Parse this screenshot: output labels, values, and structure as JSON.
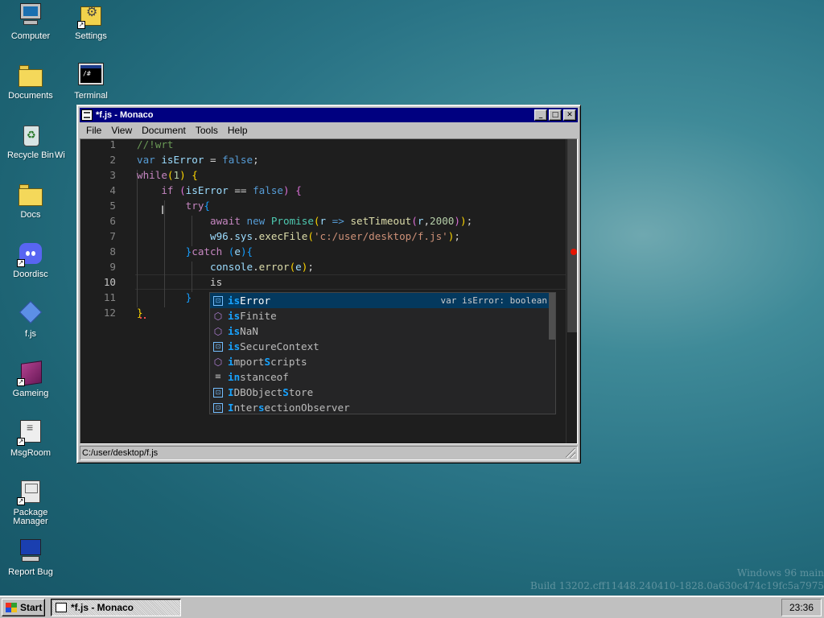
{
  "desktop": {
    "icons": [
      {
        "label": "Computer",
        "icon": "computer-icon"
      },
      {
        "label": "Settings",
        "icon": "settings-icon"
      },
      {
        "label": "Documents",
        "icon": "folder-icon"
      },
      {
        "label": "Terminal",
        "icon": "terminal-icon"
      },
      {
        "label": "Recycle Bin",
        "icon": "recycle-bin-icon"
      },
      {
        "label": "Docs",
        "icon": "folder-icon"
      },
      {
        "label": "Doordisc",
        "icon": "discord-icon"
      },
      {
        "label": "f.js",
        "icon": "diamond-file-icon"
      },
      {
        "label": "Gameing",
        "icon": "cube-icon"
      },
      {
        "label": "MsgRoom",
        "icon": "msgroom-icon"
      },
      {
        "label": "Package Manager",
        "icon": "package-icon"
      },
      {
        "label": "Report Bug",
        "icon": "report-bug-icon"
      }
    ],
    "hidden_icon_fragment": "Wi"
  },
  "window": {
    "title": "*f.js - Monaco",
    "menu": [
      "File",
      "View",
      "Document",
      "Tools",
      "Help"
    ],
    "buttons": {
      "minimize": "_",
      "maximize": "□",
      "close": "✕"
    },
    "status_path": "C:/user/desktop/f.js"
  },
  "editor": {
    "line_numbers": [
      "1",
      "2",
      "3",
      "4",
      "5",
      "6",
      "7",
      "8",
      "9",
      "10",
      "11",
      "12"
    ],
    "active_line": "10",
    "lines": [
      [
        {
          "t": "//!wrt",
          "c": "c-com"
        }
      ],
      [
        {
          "t": "var ",
          "c": "c-kw"
        },
        {
          "t": "isError",
          "c": "c-var"
        },
        {
          "t": " = ",
          "c": ""
        },
        {
          "t": "false",
          "c": "c-kw"
        },
        {
          "t": ";",
          "c": ""
        }
      ],
      [
        {
          "t": "while",
          "c": "c-ctl"
        },
        {
          "t": "(",
          "c": "c-br1"
        },
        {
          "t": "1",
          "c": "c-num"
        },
        {
          "t": ")",
          "c": "c-br1"
        },
        {
          "t": " ",
          "c": ""
        },
        {
          "t": "{",
          "c": "c-br1"
        }
      ],
      [
        {
          "t": "    if ",
          "c": "c-ctl"
        },
        {
          "t": "(",
          "c": "c-br2"
        },
        {
          "t": "isError",
          "c": "c-var"
        },
        {
          "t": " == ",
          "c": ""
        },
        {
          "t": "false",
          "c": "c-kw"
        },
        {
          "t": ")",
          "c": "c-br2"
        },
        {
          "t": " ",
          "c": ""
        },
        {
          "t": "{",
          "c": "c-br2"
        }
      ],
      [
        {
          "t": "        try",
          "c": "c-ctl"
        },
        {
          "t": "{",
          "c": "c-br3"
        }
      ],
      [
        {
          "t": "            await ",
          "c": "c-ctl"
        },
        {
          "t": "new ",
          "c": "c-kw"
        },
        {
          "t": "Promise",
          "c": "c-cls"
        },
        {
          "t": "(",
          "c": "c-br1"
        },
        {
          "t": "r",
          "c": "c-var"
        },
        {
          "t": " => ",
          "c": "c-kw"
        },
        {
          "t": "setTimeout",
          "c": "c-fn"
        },
        {
          "t": "(",
          "c": "c-br2"
        },
        {
          "t": "r",
          "c": "c-var"
        },
        {
          "t": ",",
          "c": ""
        },
        {
          "t": "2000",
          "c": "c-num"
        },
        {
          "t": ")",
          "c": "c-br2"
        },
        {
          "t": ")",
          "c": "c-br1"
        },
        {
          "t": ";",
          "c": ""
        }
      ],
      [
        {
          "t": "            w96",
          "c": "c-var"
        },
        {
          "t": ".",
          "c": ""
        },
        {
          "t": "sys",
          "c": "c-var"
        },
        {
          "t": ".",
          "c": ""
        },
        {
          "t": "execFile",
          "c": "c-fn"
        },
        {
          "t": "(",
          "c": "c-br1"
        },
        {
          "t": "'c:/user/desktop/f.js'",
          "c": "c-str"
        },
        {
          "t": ")",
          "c": "c-br1"
        },
        {
          "t": ";",
          "c": ""
        }
      ],
      [
        {
          "t": "        }",
          "c": "c-br3"
        },
        {
          "t": "catch ",
          "c": "c-ctl"
        },
        {
          "t": "(",
          "c": "c-br3"
        },
        {
          "t": "e",
          "c": "c-var"
        },
        {
          "t": ")",
          "c": "c-br3"
        },
        {
          "t": "{",
          "c": "c-br3"
        }
      ],
      [
        {
          "t": "            console",
          "c": "c-var"
        },
        {
          "t": ".",
          "c": ""
        },
        {
          "t": "error",
          "c": "c-fn"
        },
        {
          "t": "(",
          "c": "c-br1"
        },
        {
          "t": "e",
          "c": "c-var"
        },
        {
          "t": ")",
          "c": "c-br1"
        },
        {
          "t": ";",
          "c": ""
        }
      ],
      [
        {
          "t": "            is",
          "c": ""
        }
      ],
      [
        {
          "t": "        }",
          "c": "c-br3"
        }
      ],
      [
        {
          "t": "}",
          "c": "c-br1"
        }
      ]
    ]
  },
  "suggestions": [
    {
      "match": "is",
      "rest": "Error",
      "kind": "var",
      "detail": "var isError: boolean",
      "selected": true
    },
    {
      "match": "is",
      "rest": "Finite",
      "kind": "method",
      "detail": "",
      "selected": false
    },
    {
      "match": "is",
      "rest": "NaN",
      "kind": "method",
      "detail": "",
      "selected": false
    },
    {
      "match": "is",
      "rest": "SecureContext",
      "kind": "var",
      "detail": "",
      "selected": false
    },
    {
      "parts": [
        {
          "t": "i",
          "h": true
        },
        {
          "t": "mport",
          "h": false
        },
        {
          "t": "S",
          "h": true
        },
        {
          "t": "cripts",
          "h": false
        }
      ],
      "kind": "method",
      "detail": "",
      "selected": false
    },
    {
      "parts": [
        {
          "t": "in",
          "h": true
        },
        {
          "t": "stanceof",
          "h": false
        }
      ],
      "kind": "kw",
      "detail": "",
      "selected": false
    },
    {
      "parts": [
        {
          "t": "I",
          "h": true
        },
        {
          "t": "DBObject",
          "h": false
        },
        {
          "t": "S",
          "h": true
        },
        {
          "t": "tore",
          "h": false
        }
      ],
      "kind": "var",
      "detail": "",
      "selected": false
    },
    {
      "parts": [
        {
          "t": "I",
          "h": true
        },
        {
          "t": "nter",
          "h": false
        },
        {
          "t": "s",
          "h": true
        },
        {
          "t": "ectionObserver",
          "h": false
        }
      ],
      "kind": "var",
      "detail": "",
      "selected": false
    }
  ],
  "watermark": {
    "line1": "Windows 96 main",
    "line2": "Build 13202.cff11448.240410-1828.0a630c474c19fc5a7975"
  },
  "taskbar": {
    "start_label": "Start",
    "task_label": "*f.js - Monaco",
    "clock": "23:36"
  }
}
